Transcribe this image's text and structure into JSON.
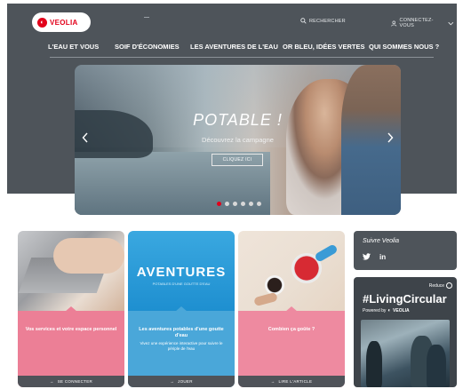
{
  "header": {
    "logo_text": "VEOLIA",
    "search_label": "RECHERCHER",
    "connect_label": "CONNECTEZ-VOUS"
  },
  "nav": {
    "items": [
      "L'EAU ET VOUS",
      "SOIF D'ÉCONOMIES",
      "LES AVENTURES DE L'EAU",
      "OR BLEU, IDÉES VERTES",
      "QUI SOMMES NOUS ?"
    ]
  },
  "hero": {
    "title": "POTABLE !",
    "subtitle": "Découvrez la campagne",
    "button_label": "CLIQUEZ ICI",
    "slide_count": 6,
    "active_slide": 1
  },
  "cards": [
    {
      "title": "Vos services et votre espace personnel",
      "description": "",
      "action": "SE CONNECTER"
    },
    {
      "image_title": "AVENTURES",
      "image_subtitle": "POTABLES D'UNE GOUTTE D'EAU",
      "title": "Les aventures potables d'une goutte d'eau",
      "description": "Vivez une expérience interactive pour suivre le périple de l'eau",
      "action": "JOUER"
    },
    {
      "title": "Combien ça goûte ?",
      "description": "",
      "action": "LIRE L'ARTICLE"
    }
  ],
  "sidebar": {
    "follow_title": "Suivre Veolia",
    "social_twitter": "🐦",
    "social_linkedin": "in",
    "reduce_label": "Reduce",
    "hashtag": "#LivingCircular",
    "powered_by": "Powered by",
    "powered_brand": "VEOLIA"
  },
  "colors": {
    "header_bg": "#4e545a",
    "brand_red": "#e2001a",
    "card_pink": "#ec7f96",
    "card_blue": "#4aa7d9",
    "card_footer": "#4f5359"
  }
}
